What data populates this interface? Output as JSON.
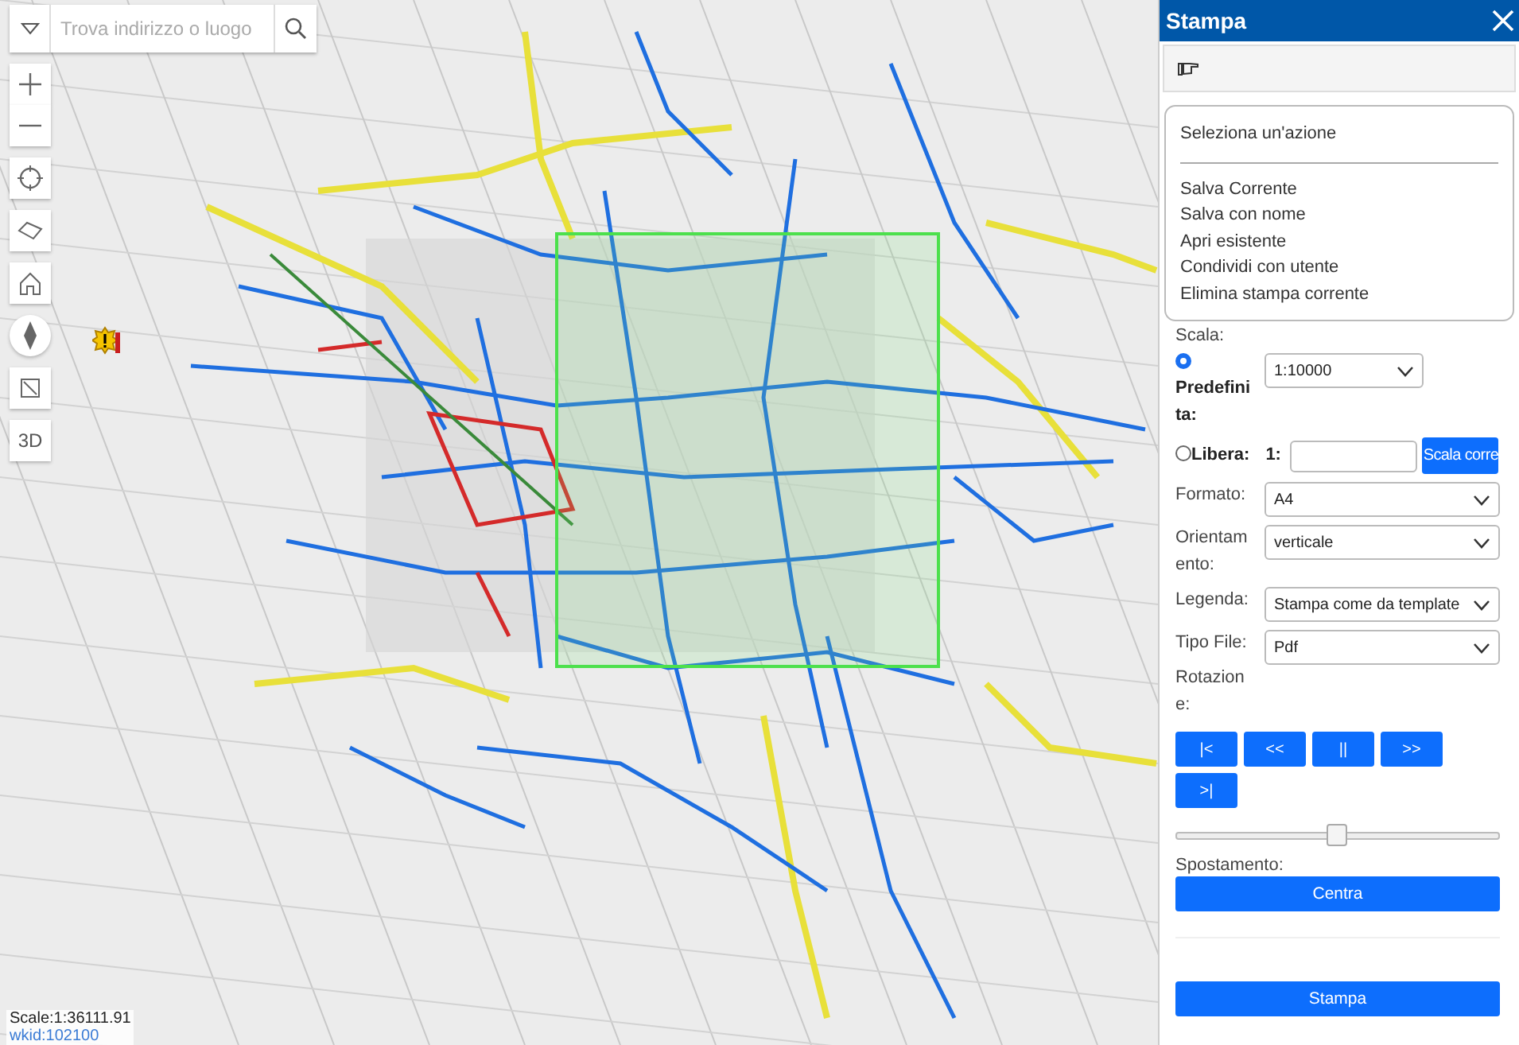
{
  "search": {
    "placeholder": "Trova indirizzo o luogo"
  },
  "map": {
    "view_button": "3D",
    "scale": "Scale:1:36111.91",
    "wkid": "wkid:102100"
  },
  "panel": {
    "title": "Stampa",
    "action_menu": {
      "heading": "Seleziona un'azione",
      "items": [
        "Salva Corrente",
        "Salva con nome",
        "Apri esistente",
        "Condividi con utente",
        "Elimina stampa corrente"
      ]
    },
    "scale": {
      "label": "Scala:",
      "options": [
        {
          "label": "Predefinita:",
          "selected": true,
          "value": "1:10000"
        },
        {
          "label": "Libera:",
          "selected": false,
          "prefix": "1:",
          "button": "Scala corre"
        }
      ]
    },
    "fields": [
      {
        "label": "Formato:",
        "value": "A4"
      },
      {
        "label": "Orientamento:",
        "value": "verticale"
      },
      {
        "label": "Legenda:",
        "value": "Stampa come da template"
      },
      {
        "label": "Tipo File:",
        "value": "Pdf"
      }
    ],
    "rotation": {
      "label": "Rotazione:",
      "buttons": [
        "|<",
        "<<",
        "||",
        ">>",
        ">|"
      ],
      "level": 0.5
    },
    "movement": {
      "label": "Spostamento:",
      "button": "Centra"
    },
    "print_button": "Stampa"
  }
}
